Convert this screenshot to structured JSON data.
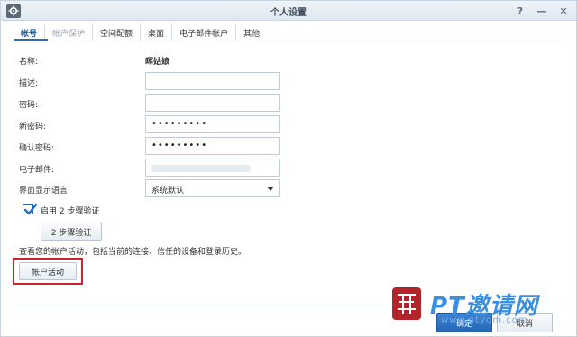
{
  "window": {
    "title": "个人设置",
    "controls": [
      "?",
      "—",
      "✕"
    ]
  },
  "tabs": [
    {
      "label": "帐号",
      "state": "active"
    },
    {
      "label": "帐户保护",
      "state": "muted"
    },
    {
      "label": "空间配额",
      "state": "normal"
    },
    {
      "label": "桌面",
      "state": "normal"
    },
    {
      "label": "电子邮件帐户",
      "state": "normal"
    },
    {
      "label": "其他",
      "state": "normal"
    }
  ],
  "form": {
    "name_label": "名称:",
    "name_value": "晖姑娘",
    "description_label": "描述:",
    "description_value": "",
    "password_label": "密码:",
    "password_value": "",
    "new_password_label": "新密码:",
    "new_password_value": "•••••••••",
    "confirm_password_label": "确认密码:",
    "confirm_password_value": "•••••••••",
    "email_label": "电子邮件:",
    "language_label": "界面显示语言:",
    "language_value": "系统默认",
    "two_step_checkbox_label": "启用 2 步骤验证",
    "two_step_checked": true,
    "two_step_button": "2 步骤验证",
    "activity_note": "查看您的帐户活动，包括当前的连接、信任的设备和登录历史。",
    "activity_button": "帐户活动"
  },
  "footer": {
    "ok_label": "确定",
    "cancel_label": "取消"
  },
  "watermark": {
    "text": "PT邀请网",
    "url": "www.ptyqm.com"
  },
  "colors": {
    "accent": "#2a6bbd",
    "highlight": "#d0202a",
    "watermark": "#3a8fe0"
  }
}
